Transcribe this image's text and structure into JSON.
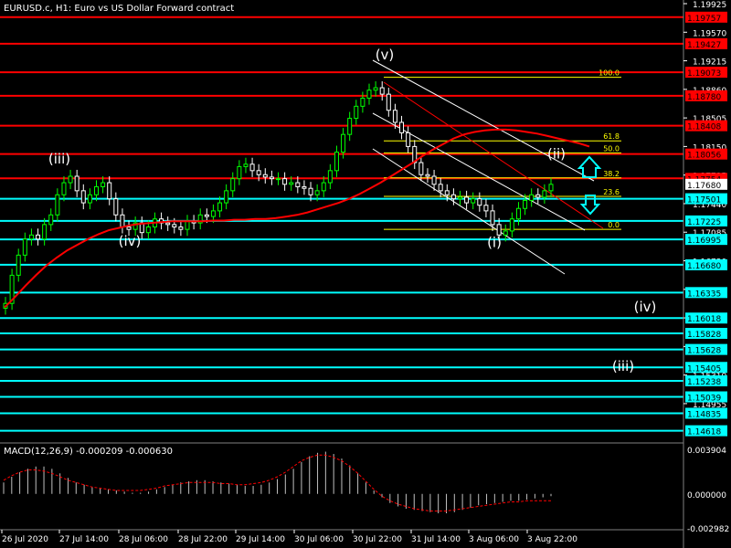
{
  "header": {
    "title": "EURUSD.c, H1:  Euro vs US Dollar Forward contract"
  },
  "colors": {
    "bull": "#00ff00",
    "bear": "#ffffff",
    "red_line": "#ff0000",
    "cyan_line": "#00ffff",
    "fib": "#ffff00",
    "channel": "#ffffff",
    "axis_text": "#ffffff",
    "price_label_red": "#ff0000",
    "price_label_cyan": "#00ffff",
    "up_arrow": "#00ffff",
    "down_arrow": "#00ffff",
    "macd_signal": "#ff0000"
  },
  "chart_data": [
    {
      "type": "candlestick",
      "title": "EURUSD.c, H1:  Euro vs US Dollar Forward contract",
      "ylim": [
        1.145,
        1.19925
      ],
      "y_ticks": [
        "1.19925",
        "1.19570",
        "1.19215",
        "1.18860",
        "1.18505",
        "1.18150",
        "1.17795",
        "1.17440",
        "1.17085",
        "1.16730",
        "1.16375",
        "1.16020",
        "1.15665",
        "1.15310",
        "1.14955"
      ],
      "x_ticks": [
        "26 Jul 2020",
        "27 Jul 14:00",
        "28 Jul 06:00",
        "28 Jul 22:00",
        "29 Jul 14:00",
        "30 Jul 06:00",
        "30 Jul 22:00",
        "31 Jul 14:00",
        "3 Aug 06:00",
        "3 Aug 22:00"
      ],
      "resistance_levels": [
        {
          "price": 1.19757,
          "label": "1.19757"
        },
        {
          "price": 1.19427,
          "label": "1.19427"
        },
        {
          "price": 1.19073,
          "label": "1.19073"
        },
        {
          "price": 1.1878,
          "label": "1.18780"
        },
        {
          "price": 1.18408,
          "label": "1.18408"
        },
        {
          "price": 1.18056,
          "label": "1.18056"
        },
        {
          "price": 1.17754,
          "label": "1.17754"
        }
      ],
      "support_levels": [
        {
          "price": 1.17501,
          "label": "1.17501"
        },
        {
          "price": 1.17225,
          "label": "1.17225"
        },
        {
          "price": 1.16995,
          "label": "1.16995"
        },
        {
          "price": 1.1668,
          "label": "1.16680"
        },
        {
          "price": 1.16335,
          "label": "1.16335"
        },
        {
          "price": 1.16018,
          "label": "1.16018"
        },
        {
          "price": 1.15828,
          "label": "1.15828"
        },
        {
          "price": 1.15628,
          "label": "1.15628"
        },
        {
          "price": 1.15405,
          "label": "1.15405"
        },
        {
          "price": 1.15238,
          "label": "1.15238"
        },
        {
          "price": 1.15039,
          "label": "1.15039"
        },
        {
          "price": 1.14835,
          "label": "1.14835"
        },
        {
          "price": 1.14618,
          "label": "1.14618"
        }
      ],
      "current_price": {
        "price": 1.1768,
        "label": "1.17680"
      },
      "fibonacci": [
        {
          "level": "100.0",
          "price": 1.1901
        },
        {
          "level": "61.8",
          "price": 1.1822
        },
        {
          "level": "50.0",
          "price": 1.1807
        },
        {
          "level": "38.2",
          "price": 1.1776
        },
        {
          "level": "23.6",
          "price": 1.1753
        },
        {
          "level": "0.0",
          "price": 1.1712
        }
      ],
      "wave_labels": [
        {
          "text": "(iii)",
          "x": 65,
          "price": 1.1794
        },
        {
          "text": "(iv)",
          "x": 142,
          "price": 1.1692
        },
        {
          "text": "(v)",
          "x": 421,
          "price": 1.1923
        },
        {
          "text": "(i)",
          "x": 541,
          "price": 1.169
        },
        {
          "text": "(ii)",
          "x": 609,
          "price": 1.18
        },
        {
          "text": "(iv)",
          "x": 706,
          "price": 1.161
        },
        {
          "text": "(iii)",
          "x": 682,
          "price": 1.1536
        }
      ],
      "close_series": [
        1.162,
        1.1655,
        1.168,
        1.17,
        1.1705,
        1.17,
        1.1718,
        1.173,
        1.1755,
        1.177,
        1.1778,
        1.176,
        1.1745,
        1.1755,
        1.1765,
        1.177,
        1.175,
        1.173,
        1.1715,
        1.1712,
        1.172,
        1.1708,
        1.1715,
        1.1725,
        1.172,
        1.1718,
        1.1715,
        1.1712,
        1.1722,
        1.172,
        1.173,
        1.1728,
        1.1735,
        1.1745,
        1.176,
        1.1775,
        1.179,
        1.1793,
        1.1785,
        1.178,
        1.1777,
        1.1775,
        1.1775,
        1.1768,
        1.177,
        1.1765,
        1.1763,
        1.1755,
        1.176,
        1.177,
        1.1785,
        1.1808,
        1.183,
        1.185,
        1.1865,
        1.1875,
        1.1885,
        1.1888,
        1.188,
        1.186,
        1.1845,
        1.1832,
        1.1815,
        1.1795,
        1.178,
        1.1778,
        1.1768,
        1.176,
        1.1755,
        1.175,
        1.1752,
        1.1745,
        1.175,
        1.1742,
        1.1735,
        1.1718,
        1.1705,
        1.171,
        1.1725,
        1.1738,
        1.1748,
        1.1755,
        1.1752,
        1.176,
        1.1768
      ],
      "ma_series": [
        1.1615,
        1.1628,
        1.1642,
        1.1655,
        1.1667,
        1.1677,
        1.1686,
        1.1693,
        1.17,
        1.1706,
        1.1711,
        1.1714,
        1.1717,
        1.1719,
        1.172,
        1.1721,
        1.1722,
        1.1722,
        1.1722,
        1.1722,
        1.1723,
        1.1723,
        1.1724,
        1.1724,
        1.1725,
        1.1725,
        1.1726,
        1.1728,
        1.173,
        1.1733,
        1.1737,
        1.1741,
        1.1745,
        1.175,
        1.1756,
        1.1763,
        1.177,
        1.1778,
        1.1786,
        1.1794,
        1.1803,
        1.1811,
        1.1818,
        1.1825,
        1.183,
        1.1833,
        1.1835,
        1.1836,
        1.1836,
        1.1835,
        1.1833,
        1.1831,
        1.1828,
        1.1825,
        1.1822,
        1.1819,
        1.1815
      ],
      "ma_start_x": 5,
      "ma_end_x": 645
    },
    {
      "type": "macd",
      "title": "MACD(12,26,9) -0.000209 -0.000630",
      "ylim": [
        -0.002982,
        0.003904
      ],
      "y_ticks": [
        "0.003904",
        "0.000000",
        "-0.002982"
      ],
      "histogram": [
        0.001,
        0.0015,
        0.0019,
        0.0022,
        0.0024,
        0.0024,
        0.0022,
        0.0018,
        0.0014,
        0.001,
        0.0008,
        0.0006,
        0.0005,
        0.0004,
        0.0003,
        0.0002,
        0.0001,
        0.0001,
        0.0002,
        0.0004,
        0.0006,
        0.0008,
        0.001,
        0.0011,
        0.0012,
        0.0012,
        0.0011,
        0.001,
        0.0009,
        0.0008,
        0.0007,
        0.0007,
        0.0008,
        0.001,
        0.0013,
        0.0017,
        0.0022,
        0.0028,
        0.0033,
        0.0036,
        0.0037,
        0.0035,
        0.0031,
        0.0025,
        0.0018,
        0.001,
        0.0003,
        -0.0003,
        -0.0008,
        -0.0011,
        -0.0013,
        -0.0014,
        -0.0015,
        -0.0016,
        -0.0017,
        -0.0017,
        -0.0016,
        -0.0014,
        -0.0012,
        -0.001,
        -0.0009,
        -0.0008,
        -0.0007,
        -0.0006,
        -0.0006,
        -0.0005,
        -0.0004,
        -0.0003,
        -0.0002
      ],
      "signal": [
        0.0012,
        0.0016,
        0.0019,
        0.0021,
        0.0021,
        0.002,
        0.0018,
        0.0015,
        0.0012,
        0.001,
        0.0008,
        0.0006,
        0.0005,
        0.0004,
        0.0003,
        0.0003,
        0.0003,
        0.0003,
        0.0004,
        0.0005,
        0.0007,
        0.0008,
        0.0009,
        0.001,
        0.001,
        0.001,
        0.001,
        0.0009,
        0.0009,
        0.0008,
        0.0008,
        0.0009,
        0.001,
        0.0012,
        0.0015,
        0.0019,
        0.0024,
        0.0029,
        0.0032,
        0.0034,
        0.0034,
        0.0032,
        0.0029,
        0.0024,
        0.0018,
        0.0011,
        0.0004,
        -0.0002,
        -0.0006,
        -0.0009,
        -0.0011,
        -0.0013,
        -0.0014,
        -0.0015,
        -0.0015,
        -0.0015,
        -0.0014,
        -0.0013,
        -0.0012,
        -0.0011,
        -0.001,
        -0.0009,
        -0.0008,
        -0.0007,
        -0.0007,
        -0.0006,
        -0.0006,
        -0.0006,
        -0.0006
      ]
    }
  ]
}
